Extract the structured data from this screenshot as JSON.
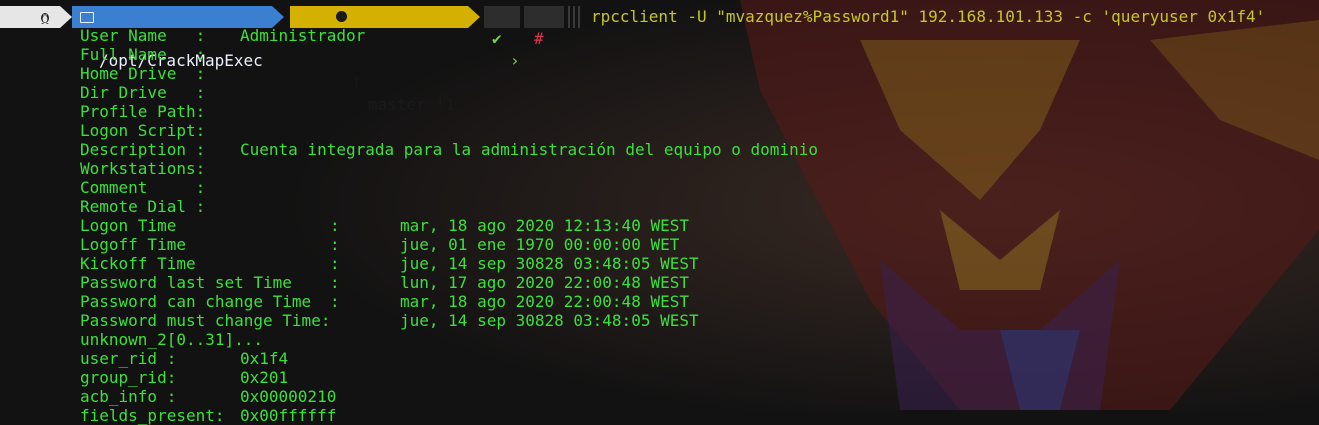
{
  "prompt": {
    "directory": "/opt/CrackMapExec",
    "git_on": "on",
    "git_branch": "master !1",
    "status_check": "✔",
    "status_sign": "#",
    "command": "rpcclient -U \"mvazquez%Password1\" 192.168.101.133 -c 'queryuser 0x1f4'"
  },
  "output": {
    "fields": [
      {
        "label": "User Name   :",
        "value": "Administrador"
      },
      {
        "label": "Full Name   :",
        "value": ""
      },
      {
        "label": "Home Drive  :",
        "value": ""
      },
      {
        "label": "Dir Drive   :",
        "value": ""
      },
      {
        "label": "Profile Path:",
        "value": ""
      },
      {
        "label": "Logon Script:",
        "value": ""
      },
      {
        "label": "Description :",
        "value": "Cuenta integrada para la administración del equipo o dominio"
      },
      {
        "label": "Workstations:",
        "value": ""
      },
      {
        "label": "Comment     :",
        "value": ""
      },
      {
        "label": "Remote Dial :",
        "value": ""
      }
    ],
    "times": [
      {
        "label": "Logon Time",
        "value": "mar, 18 ago 2020 12:13:40 WEST"
      },
      {
        "label": "Logoff Time",
        "value": "jue, 01 ene 1970 00:00:00 WET"
      },
      {
        "label": "Kickoff Time",
        "value": "jue, 14 sep 30828 03:48:05 WEST"
      },
      {
        "label": "Password last set Time",
        "value": "lun, 17 ago 2020 22:00:48 WEST"
      },
      {
        "label": "Password can change Time",
        "value": "mar, 18 ago 2020 22:00:48 WEST"
      },
      {
        "label": "Password must change Time:",
        "value": "jue, 14 sep 30828 03:48:05 WEST"
      }
    ],
    "unknown": "unknown_2[0..31]...",
    "ids": [
      {
        "label": "user_rid :",
        "value": "0x1f4"
      },
      {
        "label": "group_rid:",
        "value": "0x201"
      },
      {
        "label": "acb_info :",
        "value": "0x00000210"
      },
      {
        "label": "fields_present:",
        "value": "0x00ffffff"
      }
    ]
  },
  "colors": {
    "output_text": "#3ce03c",
    "command_text": "#c6c62a",
    "dir_segment": "#3b7fd1",
    "git_segment": "#d4b100"
  }
}
